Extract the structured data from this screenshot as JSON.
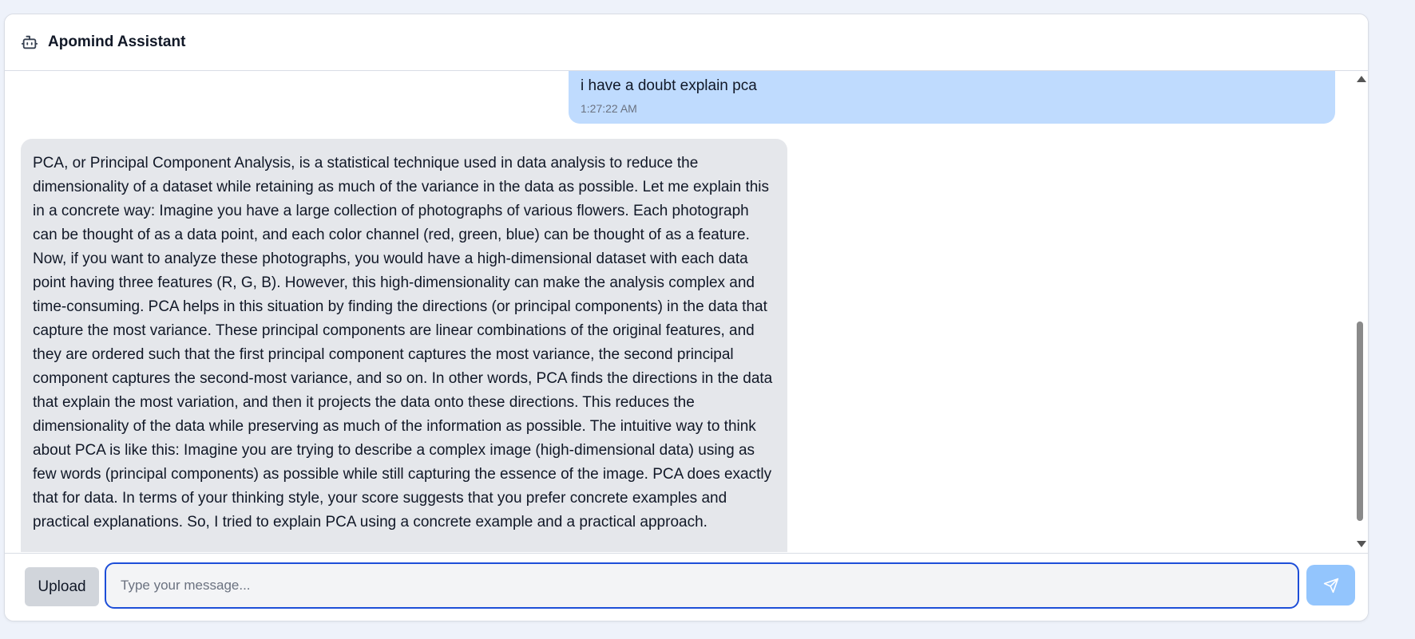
{
  "header": {
    "icon": "bot-icon",
    "title": "Apomind Assistant"
  },
  "messages": [
    {
      "role": "user",
      "text": "i have a doubt explain pca",
      "time": "1:27:22 AM"
    },
    {
      "role": "assistant",
      "text": "PCA, or Principal Component Analysis, is a statistical technique used in data analysis to reduce the dimensionality of a dataset while retaining as much of the variance in the data as possible. Let me explain this in a concrete way: Imagine you have a large collection of photographs of various flowers. Each photograph can be thought of as a data point, and each color channel (red, green, blue) can be thought of as a feature. Now, if you want to analyze these photographs, you would have a high-dimensional dataset with each data point having three features (R, G, B). However, this high-dimensionality can make the analysis complex and time-consuming. PCA helps in this situation by finding the directions (or principal components) in the data that capture the most variance. These principal components are linear combinations of the original features, and they are ordered such that the first principal component captures the most variance, the second principal component captures the second-most variance, and so on. In other words, PCA finds the directions in the data that explain the most variation, and then it projects the data onto these directions. This reduces the dimensionality of the data while preserving as much of the information as possible. The intuitive way to think about PCA is like this: Imagine you are trying to describe a complex image (high-dimensional data) using as few words (principal components) as possible while still capturing the essence of the image. PCA does exactly that for data. In terms of your thinking style, your score suggests that you prefer concrete examples and practical explanations. So, I tried to explain PCA using a concrete example and a practical approach."
    }
  ],
  "composer": {
    "upload_label": "Upload",
    "placeholder": "Type your message...",
    "value": "",
    "send_icon": "send-icon"
  },
  "colors": {
    "user_bubble": "#bfdbfe",
    "assistant_bubble": "#e5e7eb",
    "input_border": "#1d4ed8",
    "send_button": "#93c5fd"
  }
}
